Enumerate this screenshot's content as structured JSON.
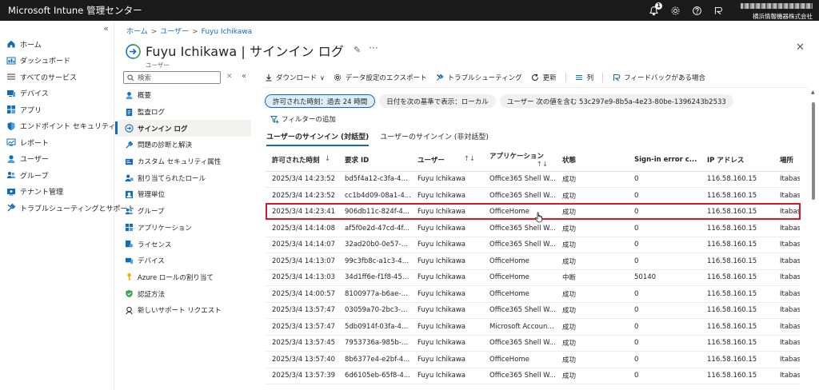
{
  "topbar": {
    "brand": "Microsoft Intune 管理センター",
    "notification_count": "1",
    "org": "横浜情報機器株式会社"
  },
  "leftnav": {
    "items": [
      {
        "label": "ホーム",
        "icon": "home-icon"
      },
      {
        "label": "ダッシュボード",
        "icon": "dashboard-icon"
      },
      {
        "label": "すべてのサービス",
        "icon": "all-services-icon"
      },
      {
        "label": "デバイス",
        "icon": "devices-icon"
      },
      {
        "label": "アプリ",
        "icon": "apps-icon"
      },
      {
        "label": "エンドポイント セキュリティ",
        "icon": "shield-icon"
      },
      {
        "label": "レポート",
        "icon": "reports-icon"
      },
      {
        "label": "ユーザー",
        "icon": "users-icon"
      },
      {
        "label": "グループ",
        "icon": "groups-icon"
      },
      {
        "label": "テナント管理",
        "icon": "tenant-icon"
      },
      {
        "label": "トラブルシューティングとサポート",
        "icon": "wrench-icon"
      }
    ]
  },
  "breadcrumb": {
    "items": [
      "ホーム",
      "ユーザー",
      "Fuyu Ichikawa"
    ]
  },
  "page": {
    "title": "Fuyu Ichikawa | サインイン ログ",
    "subtitle": "ユーザー"
  },
  "search": {
    "placeholder": "検索"
  },
  "resmenu": {
    "items": [
      {
        "label": "概要"
      },
      {
        "label": "監査ログ"
      },
      {
        "label": "サインイン ログ"
      },
      {
        "label": "問題の診断と解決"
      },
      {
        "label": "カスタム セキュリティ属性"
      },
      {
        "label": "割り当てられたロール"
      },
      {
        "label": "管理単位"
      },
      {
        "label": "グループ"
      },
      {
        "label": "アプリケーション"
      },
      {
        "label": "ライセンス"
      },
      {
        "label": "デバイス"
      },
      {
        "label": "Azure ロールの割り当て"
      },
      {
        "label": "認証方法"
      },
      {
        "label": "新しいサポート リクエスト"
      }
    ]
  },
  "toolbar": {
    "download": "ダウンロード",
    "export": "データ設定のエクスポート",
    "troubleshoot": "トラブルシューティング",
    "refresh": "更新",
    "columns": "列",
    "feedback": "フィードバックがある場合"
  },
  "filters": {
    "time": "許可された時刻：過去 24 時間",
    "date_basis": "日付を次の基準で表示：ローカル",
    "user": "ユーザー 次の値を含む 53c297e9-8b5a-4e23-80be-1396243b2533",
    "add": "フィルターの追加"
  },
  "tabs": [
    "ユーザーのサインイン (対話型)",
    "ユーザーのサインイン (非対話型)"
  ],
  "table": {
    "headers": [
      "許可された時刻",
      "要求 ID",
      "ユーザー",
      "アプリケーション",
      "状態",
      "Sign-in error c...",
      "IP アドレス",
      "場所"
    ],
    "rows": [
      [
        "2025/3/4 14:23:52",
        "bd5f4a12-c3fa-46...",
        "Fuyu Ichikawa",
        "Office365 Shell W...",
        "成功",
        "0",
        "116.58.160.15",
        "Itabasl"
      ],
      [
        "2025/3/4 14:23:52",
        "cc1b4d09-08a1-4...",
        "Fuyu Ichikawa",
        "Office365 Shell W...",
        "成功",
        "0",
        "116.58.160.15",
        "Itabasl"
      ],
      [
        "2025/3/4 14:23:41",
        "906db11c-824f-4...",
        "Fuyu Ichikawa",
        "OfficeHome",
        "成功",
        "0",
        "116.58.160.15",
        "Itabasl"
      ],
      [
        "2025/3/4 14:14:08",
        "af5f0e2d-47cd-4f...",
        "Fuyu Ichikawa",
        "Office365 Shell W...",
        "成功",
        "0",
        "116.58.160.15",
        "Itabasl"
      ],
      [
        "2025/3/4 14:14:07",
        "32ad20b0-0e57-4...",
        "Fuyu Ichikawa",
        "Office365 Shell W...",
        "成功",
        "0",
        "116.58.160.15",
        "Itabasl"
      ],
      [
        "2025/3/4 14:13:07",
        "99c3fb8c-a1c3-40...",
        "Fuyu Ichikawa",
        "OfficeHome",
        "成功",
        "0",
        "116.58.160.15",
        "Itabasl"
      ],
      [
        "2025/3/4 14:13:03",
        "34d1ff6e-f1f8-45e...",
        "Fuyu Ichikawa",
        "OfficeHome",
        "中断",
        "50140",
        "116.58.160.15",
        "Itabasl"
      ],
      [
        "2025/3/4 14:00:57",
        "8100977a-b6ae-4...",
        "Fuyu Ichikawa",
        "OfficeHome",
        "成功",
        "0",
        "116.58.160.15",
        "Itabasl"
      ],
      [
        "2025/3/4 13:57:47",
        "03059a70-2bc3-4...",
        "Fuyu Ichikawa",
        "Office365 Shell W...",
        "成功",
        "0",
        "116.58.160.15",
        "Itabasl"
      ],
      [
        "2025/3/4 13:57:47",
        "5db0914f-03fa-4a...",
        "Fuyu Ichikawa",
        "Microsoft Account...",
        "成功",
        "0",
        "116.58.160.15",
        "Itabasl"
      ],
      [
        "2025/3/4 13:57:45",
        "7953736a-985b-4...",
        "Fuyu Ichikawa",
        "Office365 Shell W...",
        "成功",
        "0",
        "116.58.160.15",
        "Itabasl"
      ],
      [
        "2025/3/4 13:57:40",
        "8b6377e4-e2bf-4...",
        "Fuyu Ichikawa",
        "OfficeHome",
        "成功",
        "0",
        "116.58.160.15",
        "Itabasl"
      ],
      [
        "2025/3/4 13:57:39",
        "6d6105eb-65f8-4...",
        "Fuyu Ichikawa",
        "Office365 Shell W...",
        "成功",
        "0",
        "116.58.160.15",
        "Itabasl"
      ]
    ]
  },
  "colors": {
    "accent": "#0f6cbd",
    "highlight": "#d01c2a",
    "topbar": "#1b1b1b"
  }
}
